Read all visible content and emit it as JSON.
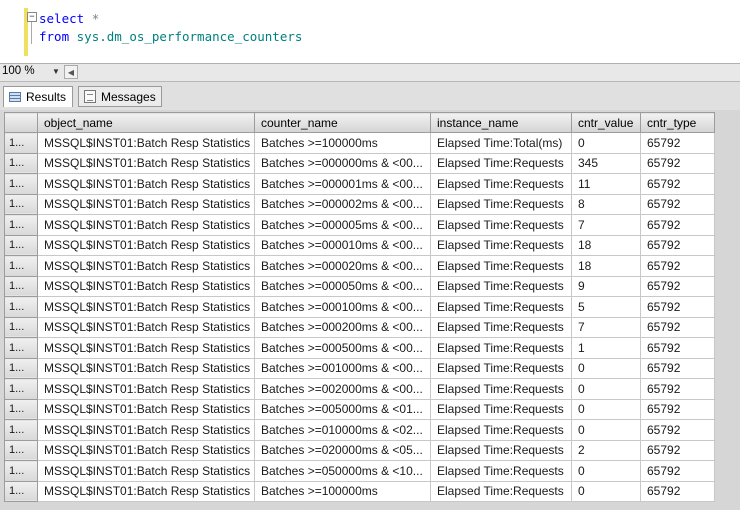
{
  "editor": {
    "line1_keyword": "select",
    "line1_operator": "*",
    "line2_keyword": "from",
    "line2_object": "sys.dm_os_performance_counters",
    "collapse_glyph": "−"
  },
  "zoom": {
    "value": "100 %",
    "dropdown_icon": "▼",
    "scroll_left_icon": "◀"
  },
  "tabs": [
    {
      "label": "Results",
      "icon": "grid-icon",
      "active": true
    },
    {
      "label": "Messages",
      "icon": "messages-icon",
      "active": false
    }
  ],
  "grid": {
    "columns": [
      "object_name",
      "counter_name",
      "instance_name",
      "cntr_value",
      "cntr_type"
    ],
    "row_header": "1...",
    "rows": [
      [
        "MSSQL$INST01:Batch Resp Statistics",
        "Batches >=100000ms",
        "Elapsed Time:Total(ms)",
        "0",
        "65792"
      ],
      [
        "MSSQL$INST01:Batch Resp Statistics",
        "Batches >=000000ms & <00...",
        "Elapsed Time:Requests",
        "345",
        "65792"
      ],
      [
        "MSSQL$INST01:Batch Resp Statistics",
        "Batches >=000001ms & <00...",
        "Elapsed Time:Requests",
        "11",
        "65792"
      ],
      [
        "MSSQL$INST01:Batch Resp Statistics",
        "Batches >=000002ms & <00...",
        "Elapsed Time:Requests",
        "8",
        "65792"
      ],
      [
        "MSSQL$INST01:Batch Resp Statistics",
        "Batches >=000005ms & <00...",
        "Elapsed Time:Requests",
        "7",
        "65792"
      ],
      [
        "MSSQL$INST01:Batch Resp Statistics",
        "Batches >=000010ms & <00...",
        "Elapsed Time:Requests",
        "18",
        "65792"
      ],
      [
        "MSSQL$INST01:Batch Resp Statistics",
        "Batches >=000020ms & <00...",
        "Elapsed Time:Requests",
        "18",
        "65792"
      ],
      [
        "MSSQL$INST01:Batch Resp Statistics",
        "Batches >=000050ms & <00...",
        "Elapsed Time:Requests",
        "9",
        "65792"
      ],
      [
        "MSSQL$INST01:Batch Resp Statistics",
        "Batches >=000100ms & <00...",
        "Elapsed Time:Requests",
        "5",
        "65792"
      ],
      [
        "MSSQL$INST01:Batch Resp Statistics",
        "Batches >=000200ms & <00...",
        "Elapsed Time:Requests",
        "7",
        "65792"
      ],
      [
        "MSSQL$INST01:Batch Resp Statistics",
        "Batches >=000500ms & <00...",
        "Elapsed Time:Requests",
        "1",
        "65792"
      ],
      [
        "MSSQL$INST01:Batch Resp Statistics",
        "Batches >=001000ms & <00...",
        "Elapsed Time:Requests",
        "0",
        "65792"
      ],
      [
        "MSSQL$INST01:Batch Resp Statistics",
        "Batches >=002000ms & <00...",
        "Elapsed Time:Requests",
        "0",
        "65792"
      ],
      [
        "MSSQL$INST01:Batch Resp Statistics",
        "Batches >=005000ms & <01...",
        "Elapsed Time:Requests",
        "0",
        "65792"
      ],
      [
        "MSSQL$INST01:Batch Resp Statistics",
        "Batches >=010000ms & <02...",
        "Elapsed Time:Requests",
        "0",
        "65792"
      ],
      [
        "MSSQL$INST01:Batch Resp Statistics",
        "Batches >=020000ms & <05...",
        "Elapsed Time:Requests",
        "2",
        "65792"
      ],
      [
        "MSSQL$INST01:Batch Resp Statistics",
        "Batches >=050000ms & <10...",
        "Elapsed Time:Requests",
        "0",
        "65792"
      ],
      [
        "MSSQL$INST01:Batch Resp Statistics",
        "Batches >=100000ms",
        "Elapsed Time:Requests",
        "0",
        "65792"
      ]
    ]
  },
  "colors": {
    "keyword": "#0000ff",
    "identifier": "#008080",
    "operator": "#808080",
    "margin_highlight": "#f0e060"
  }
}
